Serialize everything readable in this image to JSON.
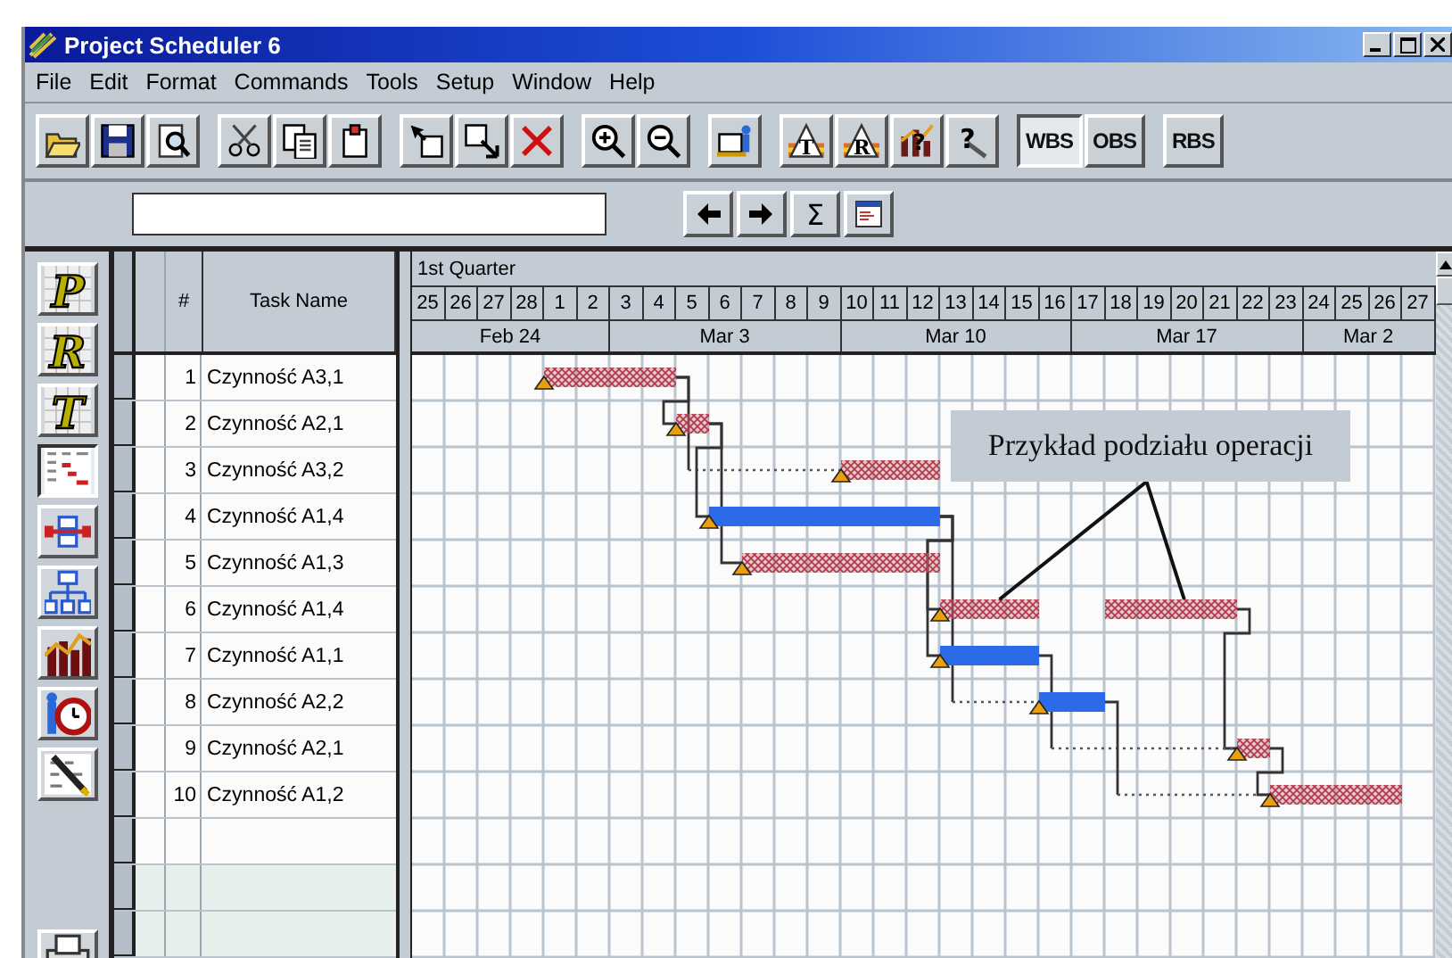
{
  "window": {
    "title": "Project Scheduler 6"
  },
  "menu": [
    "File",
    "Edit",
    "Format",
    "Commands",
    "Tools",
    "Setup",
    "Window",
    "Help"
  ],
  "toolbar": [
    [
      {
        "kind": "open"
      },
      {
        "kind": "save"
      },
      {
        "kind": "preview"
      }
    ],
    [
      {
        "kind": "cut"
      },
      {
        "kind": "copy"
      },
      {
        "kind": "paste"
      }
    ],
    [
      {
        "kind": "pointer"
      },
      {
        "kind": "link"
      },
      {
        "kind": "delete"
      }
    ],
    [
      {
        "kind": "zoom-in"
      },
      {
        "kind": "zoom-out"
      }
    ],
    [
      {
        "kind": "resource"
      }
    ],
    [
      {
        "kind": "tri-letter",
        "label": "T"
      },
      {
        "kind": "tri-letter",
        "label": "R"
      },
      {
        "kind": "chart",
        "label": "?"
      },
      {
        "kind": "help",
        "label": "?"
      }
    ],
    [
      {
        "kind": "text",
        "label": "WBS",
        "selected": true
      },
      {
        "kind": "text",
        "label": "OBS",
        "selected": false
      }
    ],
    [
      {
        "kind": "text",
        "label": "RBS",
        "selected": false
      }
    ]
  ],
  "toolbar2": {
    "buttons": [
      {
        "kind": "left"
      },
      {
        "kind": "right"
      },
      {
        "kind": "text",
        "label": "Σ"
      },
      {
        "kind": "chart-view"
      }
    ]
  },
  "sidebar": [
    {
      "kind": "letter",
      "label": "P",
      "selected": false
    },
    {
      "kind": "letter",
      "label": "R",
      "selected": false
    },
    {
      "kind": "letter",
      "label": "T",
      "selected": false
    },
    {
      "kind": "gantt",
      "selected": true
    },
    {
      "kind": "network",
      "selected": false
    },
    {
      "kind": "org",
      "selected": false
    },
    {
      "kind": "histogram",
      "selected": false
    },
    {
      "kind": "clock",
      "selected": false
    },
    {
      "kind": "pen",
      "selected": false
    },
    {
      "kind": "printer",
      "selected": false
    }
  ],
  "table": {
    "columns": [
      "#",
      "Task Name"
    ],
    "rows": [
      {
        "number": "1",
        "name": "Czynność A3,1"
      },
      {
        "number": "2",
        "name": "Czynność A2,1"
      },
      {
        "number": "3",
        "name": "Czynność A3,2"
      },
      {
        "number": "4",
        "name": "Czynność A1,4"
      },
      {
        "number": "5",
        "name": "Czynność A1,3"
      },
      {
        "number": "6",
        "name": "Czynność A1,4"
      },
      {
        "number": "7",
        "name": "Czynność A1,1"
      },
      {
        "number": "8",
        "name": "Czynność A2,2"
      },
      {
        "number": "9",
        "name": "Czynność A2,1"
      },
      {
        "number": "10",
        "name": "Czynność A1,2"
      }
    ]
  },
  "timeline": {
    "quarter": "1st Quarter",
    "weeks": [
      {
        "label": "Feb 24",
        "days": [
          "25",
          "26",
          "27",
          "28",
          "1",
          "2"
        ]
      },
      {
        "label": "Mar 3",
        "days": [
          "3",
          "4",
          "5",
          "6",
          "7",
          "8",
          "9"
        ]
      },
      {
        "label": "Mar 10",
        "days": [
          "10",
          "11",
          "12",
          "13",
          "14",
          "15",
          "16"
        ]
      },
      {
        "label": "Mar 17",
        "days": [
          "17",
          "18",
          "19",
          "20",
          "21",
          "22",
          "23"
        ]
      },
      {
        "label": "Mar 2",
        "days": [
          "24",
          "25",
          "26",
          "27"
        ]
      }
    ]
  },
  "gantt": {
    "bars": [
      {
        "kind": "hatched"
      },
      {
        "kind": "hatched"
      },
      {
        "kind": "hatched"
      },
      {
        "kind": "solid"
      },
      {
        "kind": "hatched"
      },
      {
        "kind": "hatched"
      },
      {
        "kind": "solid"
      },
      {
        "kind": "solid"
      },
      {
        "kind": "hatched"
      },
      {
        "kind": "hatched"
      }
    ],
    "callout": {
      "text": "Przykład podziału operacji"
    }
  }
}
